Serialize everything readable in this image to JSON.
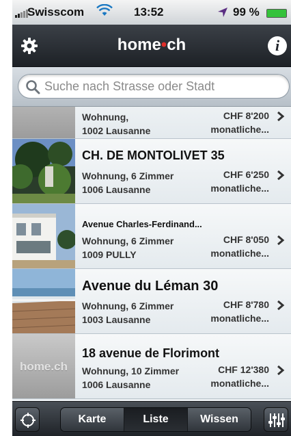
{
  "status_bar": {
    "carrier": "Swisscom",
    "time": "13:52",
    "battery": "99 %",
    "battery_level": 0.99
  },
  "nav": {
    "title_left": "home",
    "title_dot": "•",
    "title_right": "ch",
    "info_label": "i"
  },
  "search": {
    "placeholder": "Suche nach Strasse oder Stadt",
    "value": ""
  },
  "listings": [
    {
      "title": "",
      "type": "Wohnung,",
      "location": "1002 Lausanne",
      "price": "CHF 8'200",
      "period": "monatliche..."
    },
    {
      "title": "CH. DE MONTOLIVET 35",
      "type": "Wohnung, 6 Zimmer",
      "location": "1006 Lausanne",
      "price": "CHF 6'250",
      "period": "monatliche..."
    },
    {
      "title": "Avenue Charles-Ferdinand...",
      "type": "Wohnung, 6 Zimmer",
      "location": "1009 PULLY",
      "price": "CHF 8'050",
      "period": "monatliche..."
    },
    {
      "title": "Avenue du Léman 30",
      "type": "Wohnung, 6 Zimmer",
      "location": "1003 Lausanne",
      "price": "CHF 8'780",
      "period": "monatliche..."
    },
    {
      "title": "18 avenue de Florimont",
      "type": "Wohnung, 10 Zimmer",
      "location": "1006 Lausanne",
      "price": "CHF 12'380",
      "period": "monatliche..."
    }
  ],
  "placeholder_logo": "home.ch",
  "tabs": {
    "items": [
      "Karte",
      "Liste",
      "Wissen"
    ],
    "active": "Liste"
  },
  "colors": {
    "accent_red": "#e12f2b",
    "nav_dark": "#1d2126",
    "battery_green": "#35c23b"
  },
  "icons": {
    "settings": "gear-icon",
    "info": "info-icon",
    "search": "search-icon",
    "locate": "locate-icon",
    "filter": "sliders-icon",
    "chevron": "chevron-right-icon"
  }
}
